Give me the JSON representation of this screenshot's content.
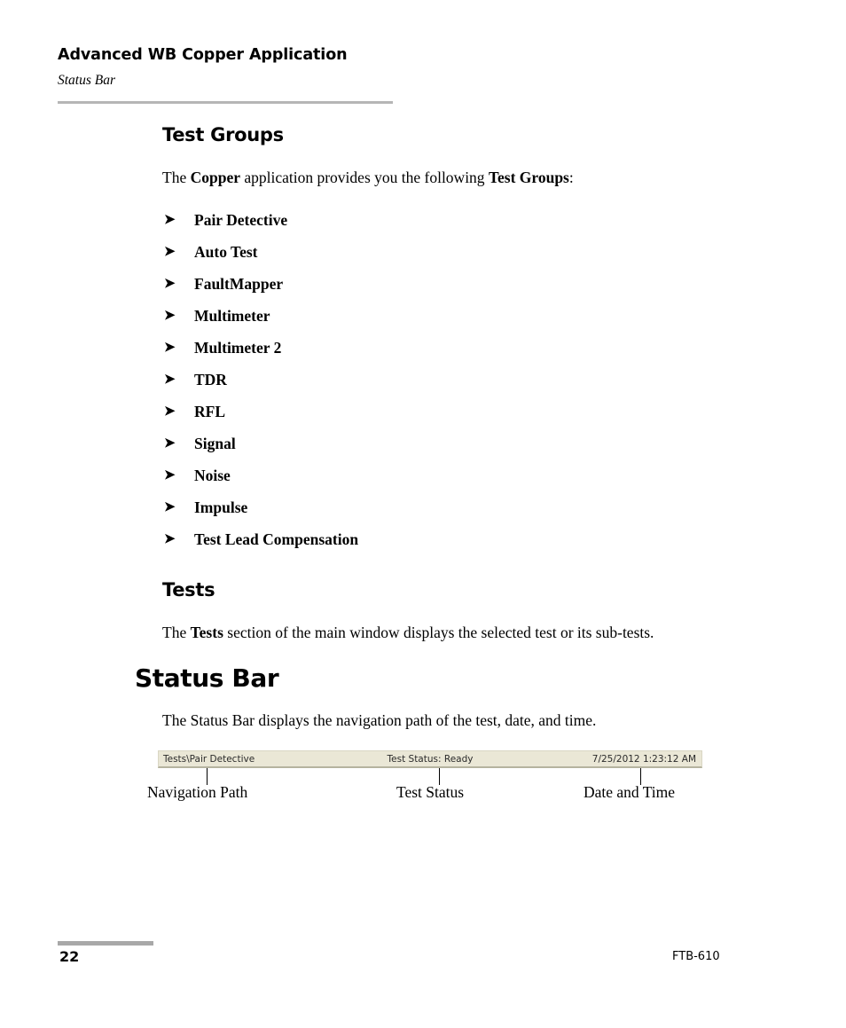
{
  "header": {
    "title": "Advanced WB Copper Application",
    "subtitle": "Status Bar"
  },
  "sections": {
    "test_groups": {
      "heading": "Test Groups",
      "intro_prefix": "The ",
      "intro_bold1": "Copper",
      "intro_middle": " application provides you the following ",
      "intro_bold2": "Test Groups",
      "intro_suffix": ":",
      "bullet_icon": "➤",
      "items": [
        "Pair Detective",
        "Auto Test",
        "FaultMapper",
        "Multimeter",
        "Multimeter 2",
        "TDR",
        "RFL",
        "Signal",
        "Noise",
        "Impulse",
        "Test Lead Compensation"
      ]
    },
    "tests": {
      "heading": "Tests",
      "body_prefix": "The ",
      "body_bold": "Tests",
      "body_suffix": " section of the main window displays the selected test or its sub-tests."
    },
    "status_bar": {
      "heading": "Status Bar",
      "body": "The Status Bar displays the navigation path of the test, date, and time.",
      "figure": {
        "navigation_path": "Tests\\Pair Detective",
        "test_status": "Test Status: Ready",
        "date_time": "7/25/2012 1:23:12 AM",
        "callouts": [
          "Navigation Path",
          "Test Status",
          "Date and Time"
        ],
        "bar_fill_color": "#EAE7D6",
        "bar_border_color": "#B5B39F"
      }
    }
  },
  "footer": {
    "page_number": "22",
    "product_code": "FTB-610"
  }
}
